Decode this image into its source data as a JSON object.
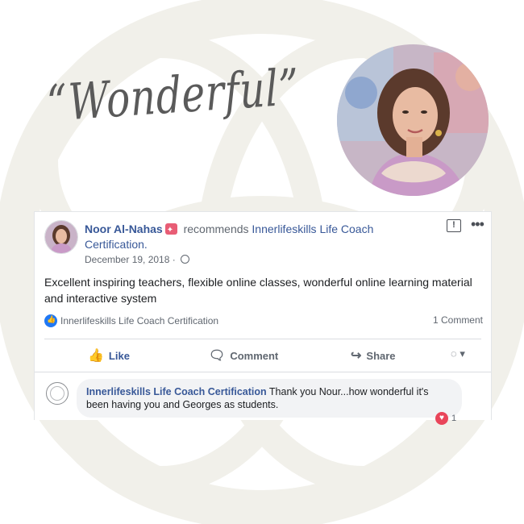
{
  "headline_script": "“Wonderful”",
  "post": {
    "author": "Noor Al-Nahas",
    "verb": "recommends",
    "page": "Innerlifeskills Life Coach Certification.",
    "date": "December 19, 2018 ·",
    "text": "Excellent inspiring teachers, flexible online classes, wonderful online learning material and interactive system",
    "like_summary": "Innerlifeskills Life Coach Certification",
    "comment_count": "1 Comment"
  },
  "actions": {
    "like": "Like",
    "comment": "Comment",
    "share": "Share"
  },
  "reply": {
    "author": "Innerlifeskills Life Coach Certification",
    "text": "Thank you Nour...how wonderful it's been having you and Georges as students.",
    "reaction_count": "1"
  },
  "colors": {
    "link": "#385898",
    "badge": "#e85d75",
    "like_blue": "#2078f4",
    "love_red": "#e9455a",
    "ring": "#f1f0ea"
  },
  "icons": [
    "recommend-badge-icon",
    "globe-icon",
    "report-icon",
    "more-icon",
    "like-icon",
    "comment-icon",
    "share-icon",
    "audience-icon",
    "love-icon"
  ]
}
